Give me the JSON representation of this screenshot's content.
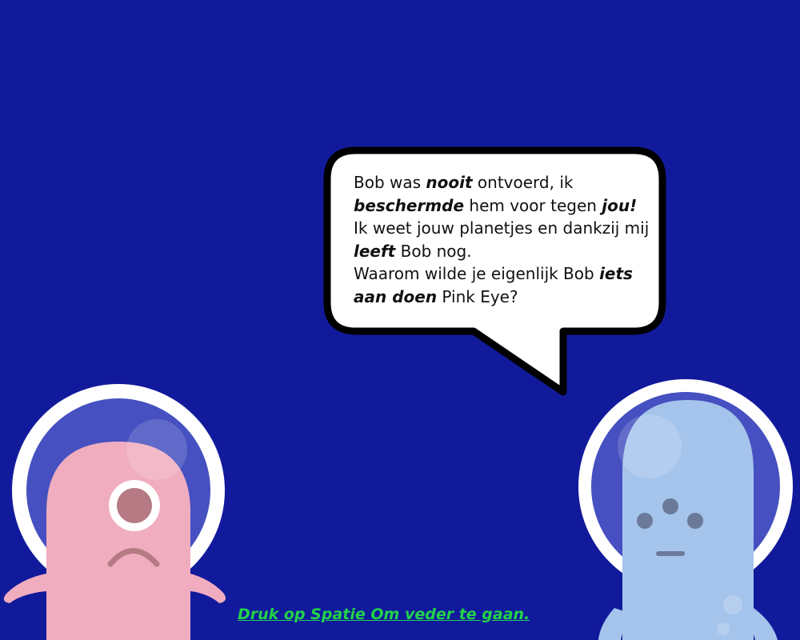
{
  "scene": {
    "background_color": "#121a9c"
  },
  "speech_bubble": {
    "lines": [
      [
        {
          "t": "Bob was "
        },
        {
          "t": "nooit",
          "em": true
        },
        {
          "t": " ontvoerd, ik"
        }
      ],
      [
        {
          "t": "beschermde",
          "em": true
        },
        {
          "t": " hem voor tegen "
        },
        {
          "t": "jou!",
          "em": true
        }
      ],
      [
        {
          "t": "Ik weet jouw planetjes en dankzij mij"
        }
      ],
      [
        {
          "t": "leeft",
          "em": true
        },
        {
          "t": " Bob nog."
        }
      ],
      [
        {
          "t": "Waarom wilde je eigenlijk Bob "
        },
        {
          "t": "iets",
          "em": true
        }
      ],
      [
        {
          "t": "aan doen",
          "em": true
        },
        {
          "t": " Pink Eye?"
        }
      ]
    ]
  },
  "characters": {
    "left": {
      "name": "Pink Eye",
      "body_color": "#f0adc0",
      "eye_color": "#b57a84"
    },
    "right": {
      "name": "Bob",
      "body_color": "#a4c4ec",
      "feature_color": "#6a7a98"
    }
  },
  "prompt": {
    "text": "Druk op Spatie Om veder te gaan.",
    "color": "#22d24a"
  }
}
